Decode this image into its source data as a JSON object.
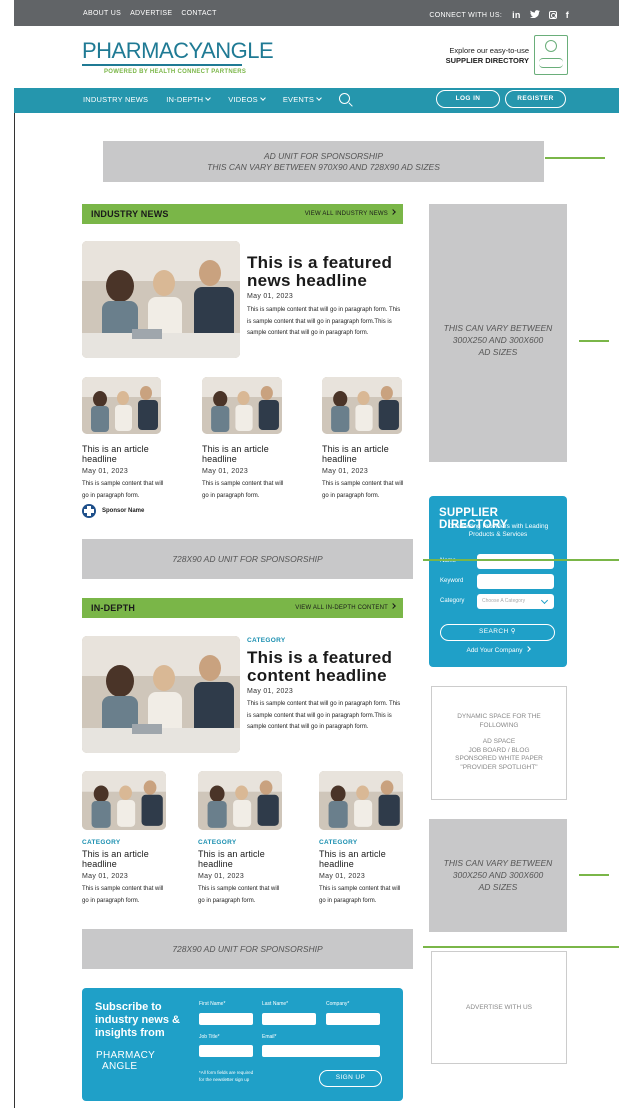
{
  "topbar": {
    "links": [
      "ABOUT US",
      "ADVERTISE",
      "CONTACT"
    ],
    "connect_label": "CONNECT WITH US:",
    "social_icons": [
      "linkedin-icon",
      "twitter-icon",
      "instagram-icon",
      "facebook-icon"
    ]
  },
  "header": {
    "logo_text": "PHARMACYANGLE",
    "logo_sub": "POWERED BY HEALTH CONNECT PARTNERS",
    "promo_line1": "Explore our easy-to-use",
    "promo_line2": "SUPPLIER DIRECTORY"
  },
  "nav": {
    "items": [
      "INDUSTRY NEWS",
      "IN-DEPTH",
      "VIDEOS",
      "EVENTS"
    ],
    "login": "LOG IN",
    "register": "REGISTER"
  },
  "ads": {
    "top_line1": "AD UNIT FOR SPONSORSHIP",
    "top_line2": "THIS CAN VARY BETWEEN 970X90 AND 728X90 AD SIZES",
    "side_line1": "THIS CAN VARY BETWEEN",
    "side_line2": "300X250 AND 300X600",
    "side_line3": "AD SIZES",
    "mid": "728X90 AD UNIT FOR SPONSORSHIP"
  },
  "industry_news": {
    "title": "INDUSTRY NEWS",
    "view_all": "VIEW ALL INDUSTRY NEWS",
    "featured": {
      "headline": "This is a featured news headline",
      "date": "May 01, 2023",
      "body": "This is sample content that will go in paragraph form. This is sample content that will go in paragraph form.This is sample content that will go in paragraph form."
    },
    "articles": [
      {
        "headline": "This is an article headline",
        "date": "May 01, 2023",
        "body": "This is sample content that will go in paragraph form."
      },
      {
        "headline": "This is an article headline",
        "date": "May 01, 2023",
        "body": "This is sample content that will go in paragraph form."
      },
      {
        "headline": "This is an article headline",
        "date": "May 01, 2023",
        "body": "This is sample content that will go in paragraph form."
      }
    ],
    "sponsor": "Sponsor Name"
  },
  "in_depth": {
    "title": "IN-DEPTH",
    "view_all": "VIEW ALL IN-DEPTH CONTENT",
    "featured": {
      "category": "CATEGORY",
      "headline": "This is a featured content headline",
      "date": "May 01, 2023",
      "body": "This is sample content that will go in paragraph form. This is sample content that will go in paragraph form.This is sample content that will go in paragraph form."
    },
    "articles": [
      {
        "category": "CATEGORY",
        "headline": "This is an article headline",
        "date": "May 01, 2023",
        "body": "This is sample content that will go in paragraph form."
      },
      {
        "category": "CATEGORY",
        "headline": "This is an article headline",
        "date": "May 01, 2023",
        "body": "This is sample content that will go in paragraph form."
      },
      {
        "category": "CATEGORY",
        "headline": "This is an article headline",
        "date": "May 01, 2023",
        "body": "This is sample content that will go in paragraph form."
      }
    ]
  },
  "supplier_directory": {
    "title": "SUPPLIER DIRECTORY",
    "subtitle": "Connecting Providers with Leading Products & Services",
    "name_label": "Name",
    "keyword_label": "Keyword",
    "category_label": "Category",
    "category_placeholder": "Choose A Category",
    "search": "SEARCH",
    "add_company": "Add Your Company"
  },
  "dynamic_space": {
    "line1": "DYNAMIC SPACE FOR THE FOLLOWING",
    "line2": "AD SPACE",
    "line3": "JOB BOARD / BLOG",
    "line4": "SPONSORED WHITE PAPER",
    "line5": "\"PROVIDER SPOTLIGHT\""
  },
  "advertise_with_us": "ADVERTISE WITH US",
  "subscribe": {
    "heading": "Subscribe to industry news & insights from",
    "first_name": "First Name*",
    "last_name": "Last Name*",
    "company": "Company*",
    "job_title": "Job Title*",
    "email": "Email*",
    "note_line1": "*All form fields are required",
    "note_line2": "for the newsletter sign up",
    "signup": "SIGN UP",
    "logo_line1": "PHARMACY",
    "logo_line2": "ANGLE"
  },
  "colors": {
    "teal": "#2596ad",
    "green": "#7ab648",
    "blue": "#1fa0c8",
    "topbar": "#616467"
  }
}
